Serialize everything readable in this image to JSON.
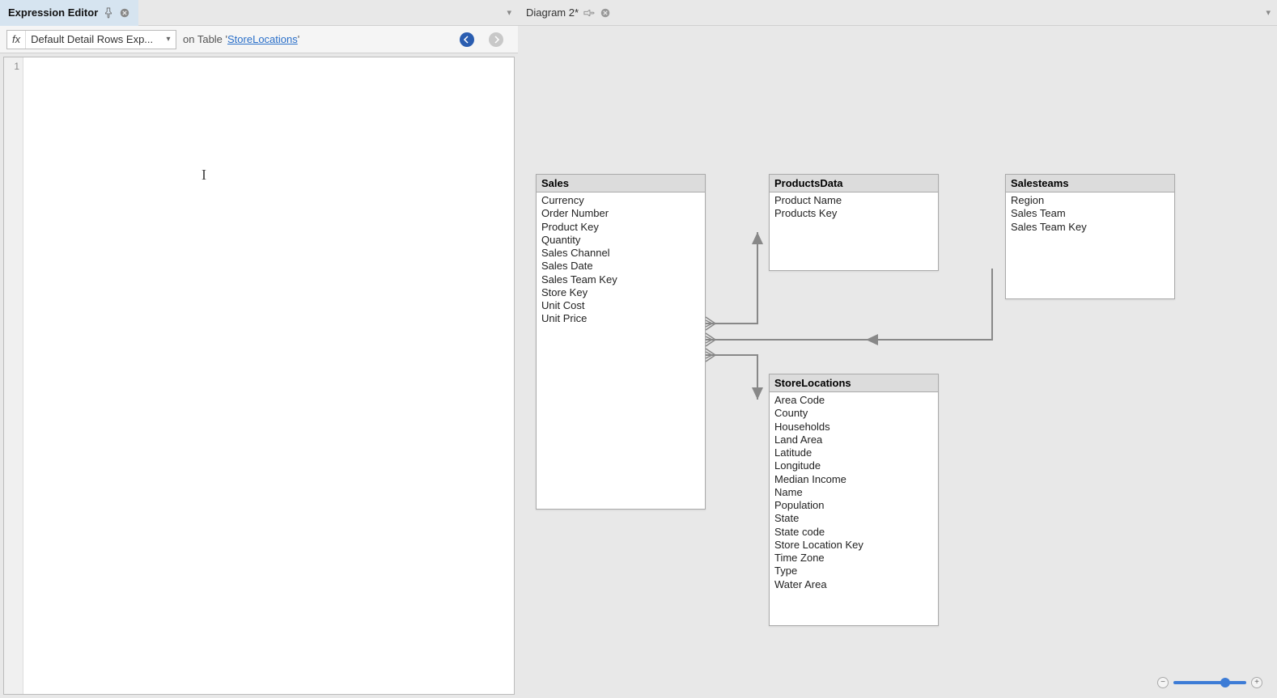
{
  "leftPanel": {
    "tabTitle": "Expression Editor",
    "toolbar": {
      "fxLabel": "fx",
      "dropdownText": "Default Detail Rows Exp...",
      "contextPrefix": "on Table '",
      "contextLink": "StoreLocations",
      "contextSuffix": "'"
    },
    "gutterLine": "1"
  },
  "rightPanel": {
    "tabTitle": "Diagram 2*"
  },
  "tables": {
    "sales": {
      "title": "Sales",
      "cols": [
        "Currency",
        "Order Number",
        "Product Key",
        "Quantity",
        "Sales Channel",
        "Sales Date",
        "Sales Team Key",
        "Store Key",
        "Unit Cost",
        "Unit Price"
      ]
    },
    "productsData": {
      "title": "ProductsData",
      "cols": [
        "Product Name",
        "Products Key"
      ]
    },
    "salesteams": {
      "title": "Salesteams",
      "cols": [
        "Region",
        "Sales Team",
        "Sales Team Key"
      ]
    },
    "storeLocations": {
      "title": "StoreLocations",
      "cols": [
        "Area Code",
        "County",
        "Households",
        "Land Area",
        "Latitude",
        "Longitude",
        "Median Income",
        "Name",
        "Population",
        "State",
        "State code",
        "Store Location Key",
        "Time Zone",
        "Type",
        "Water Area"
      ]
    }
  }
}
